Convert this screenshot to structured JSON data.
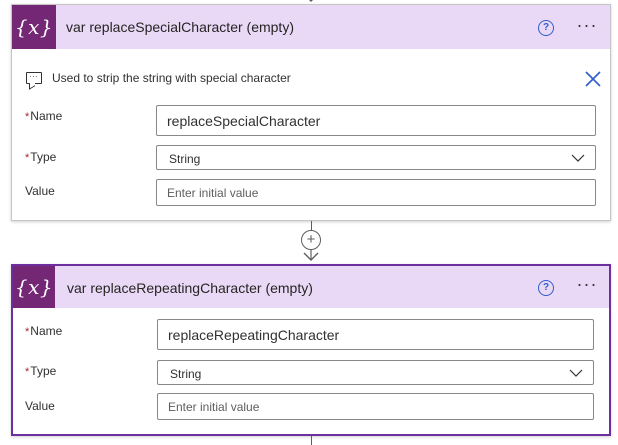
{
  "card1": {
    "title": "var replaceSpecialCharacter (empty)",
    "icon": "{x}",
    "comment": "Used to strip the string with special character",
    "name_label": "Name",
    "name_value": "replaceSpecialCharacter",
    "type_label": "Type",
    "type_value": "String",
    "value_label": "Value",
    "value_placeholder": "Enter initial value"
  },
  "card2": {
    "title": "var replaceRepeatingCharacter (empty)",
    "icon": "{x}",
    "name_label": "Name",
    "name_value": "replaceRepeatingCharacter",
    "type_label": "Type",
    "type_value": "String",
    "value_label": "Value",
    "value_placeholder": "Enter initial value"
  },
  "required_marker": "*",
  "help_glyph": "?",
  "more_glyph": "···",
  "add_step_glyph": "+",
  "colors": {
    "header_bg": "#ead9f6",
    "icon_bg": "#742774",
    "selected_border": "#6d2fa0",
    "help_blue": "#2f5dcc",
    "required_red": "#a4262c"
  }
}
